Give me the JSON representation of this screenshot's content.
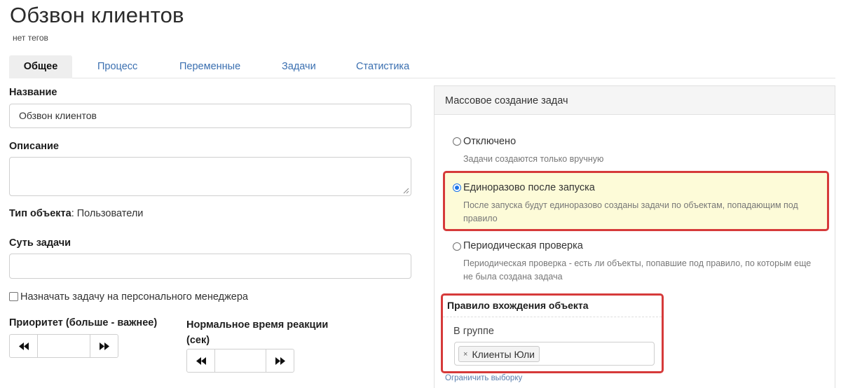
{
  "page": {
    "title": "Обзвон клиентов",
    "tags": "нет тегов"
  },
  "tabs": [
    {
      "label": "Общее",
      "active": true
    },
    {
      "label": "Процесс",
      "active": false
    },
    {
      "label": "Переменные",
      "active": false
    },
    {
      "label": "Задачи",
      "active": false
    },
    {
      "label": "Статистика",
      "active": false
    }
  ],
  "form": {
    "name_label": "Название",
    "name_value": "Обзвон клиентов",
    "description_label": "Описание",
    "description_value": "",
    "object_type_label": "Тип объекта",
    "object_type_value": "Пользователи",
    "task_essence_label": "Суть задачи",
    "task_essence_value": "",
    "assign_manager_label": "Назначать задачу на персонального менеджера",
    "assign_manager_checked": false,
    "priority_label": "Приоритет (больше - важнее)",
    "priority_value": "",
    "reaction_label_line1": "Нормальное время реакции",
    "reaction_label_line2": "(сек)",
    "reaction_value": "",
    "stepper_prev_icon": "double-left-arrow",
    "stepper_next_icon": "double-right-arrow"
  },
  "mass_creation": {
    "title": "Массовое создание задач",
    "options": [
      {
        "label": "Отключено",
        "description": "Задачи создаются только вручную",
        "selected": false
      },
      {
        "label": "Единоразово после запуска",
        "description_line1": "После запуска будут единоразово созданы задачи по объектам, попадающим под",
        "description_line2": "правило",
        "selected": true
      },
      {
        "label": "Периодическая проверка",
        "description_line1": "Периодическая проверка - есть ли объекты, попавшие под правило, по которым еще",
        "description_line2": "не была создана задача",
        "selected": false
      }
    ],
    "rule": {
      "title": "Правило вхождения объекта",
      "subtitle": "В группе",
      "chip_label": "Клиенты Юли",
      "chip_remove": "×"
    },
    "limit_link": "Ограничить выборку"
  },
  "colors": {
    "accent": "#1a73e8",
    "link": "#3a6fb0",
    "highlight_border": "#d63a3a",
    "highlight_fill": "#fdfbd8"
  }
}
